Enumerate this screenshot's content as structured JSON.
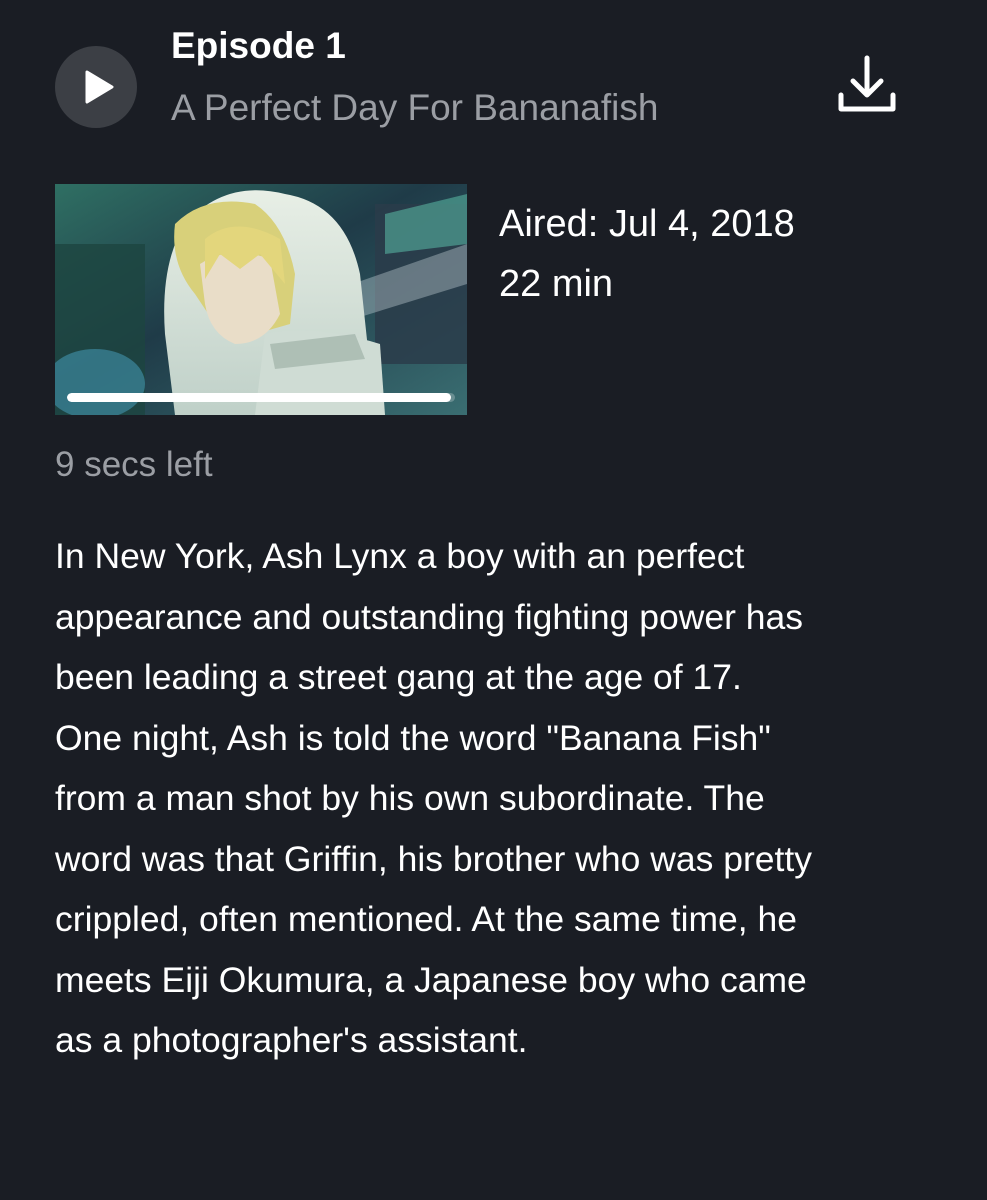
{
  "episode": {
    "number_label": "Episode 1",
    "title": "A Perfect Day For Bananafish",
    "aired": "Aired: Jul 4, 2018",
    "duration": "22 min",
    "time_left": "9 secs left",
    "progress_fraction": 0.99,
    "synopsis": "In New York, Ash Lynx a boy with an perfect appearance and outstanding fighting power has been leading a street gang at the age of 17. One night, Ash is told the word \"Banana Fish\" from a man shot by his own subordinate. The word was that Griffin, his brother who was pretty crippled, often mentioned. At the same time, he meets Eiji Okumura, a Japanese boy who came as a photographer's assistant."
  },
  "icons": {
    "play": "play-icon",
    "download": "download-icon"
  },
  "colors": {
    "background": "#1a1d24",
    "secondary_text": "#9b9ea4",
    "play_button_bg": "#3c3f45",
    "primary_text": "#ffffff"
  }
}
